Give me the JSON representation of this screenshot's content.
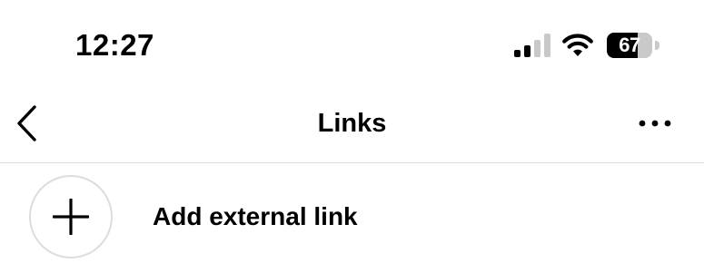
{
  "status_bar": {
    "time": "12:27",
    "battery_percent": "67",
    "battery_level": 0.67,
    "signal_bars_active": 2,
    "signal_bars_total": 4
  },
  "header": {
    "title": "Links",
    "back_icon": "chevron-left-icon",
    "more_icon": "more-horizontal-icon"
  },
  "add_link": {
    "label": "Add external link",
    "icon": "plus-icon"
  },
  "colors": {
    "text": "#000000",
    "divider": "#dbdbdb",
    "circle_border": "#dcdcdc",
    "battery_empty": "#c9c9c9",
    "signal_inactive": "#c8c8c8"
  }
}
